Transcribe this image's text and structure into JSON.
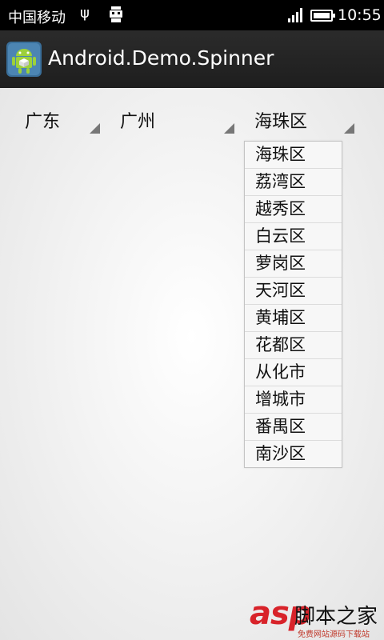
{
  "statusbar": {
    "carrier": "中国移动",
    "time": "10:55",
    "icons": [
      "usb-icon",
      "android-debug-icon",
      "signal-icon",
      "battery-icon"
    ]
  },
  "actionbar": {
    "title": "Android.Demo.Spinner",
    "icon": "android-app-icon"
  },
  "spinners": {
    "province": "广东",
    "city": "广州",
    "district": "海珠区"
  },
  "dropdown": {
    "items": [
      "海珠区",
      "荔湾区",
      "越秀区",
      "白云区",
      "萝岗区",
      "天河区",
      "黄埔区",
      "花都区",
      "从化市",
      "增城市",
      "番禺区",
      "南沙区"
    ]
  },
  "watermark": {
    "brand": "asp",
    "cn": "脚本之家",
    "sub": "免费网站源码下载站"
  },
  "colors": {
    "statusbar": "#000000",
    "actionbar": "#2b2b2b",
    "watermark_red": "#d8232a"
  }
}
